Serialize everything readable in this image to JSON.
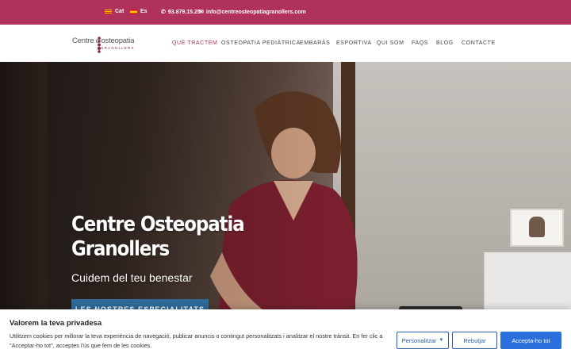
{
  "topbar": {
    "lang_cat": "Cat",
    "lang_es": "Es",
    "phone": "93.879.15.25",
    "email": "info@centreosteopatiagranollers.com"
  },
  "logo": {
    "line1": "Centre d'osteopatia",
    "line2": "GRANOLLERS"
  },
  "nav": {
    "items": [
      "QUÈ TRACTEM",
      "OSTEOPATIA PEDIÀTRICA",
      "EMBARÀS",
      "ESPORTIVA",
      "QUI SOM",
      "FAQS",
      "BLOG",
      "CONTACTE"
    ],
    "active_color": "#b0325a"
  },
  "hero": {
    "title": "Centre Osteopatia Granollers",
    "subtitle": "Cuidem del teu benestar",
    "cta": "LES NOSTRES ESPECIALITATS"
  },
  "cookie": {
    "title": "Valorem la teva privadesa",
    "text": "Utilitzem cookies per millorar la teva experiència de navegació, publicar anuncis o contingut personalitzats i analitzar el nostre trànsit. En fer clic a \"Acceptar-ho tot\", acceptes l'ús que fem de les cookies.",
    "customize": "Personalitzar",
    "reject": "Rebutjar",
    "accept": "Accepta-ho tot"
  },
  "colors": {
    "brand": "#b0325a",
    "cta": "#2e6a9a",
    "accept": "#2a6fdb"
  }
}
